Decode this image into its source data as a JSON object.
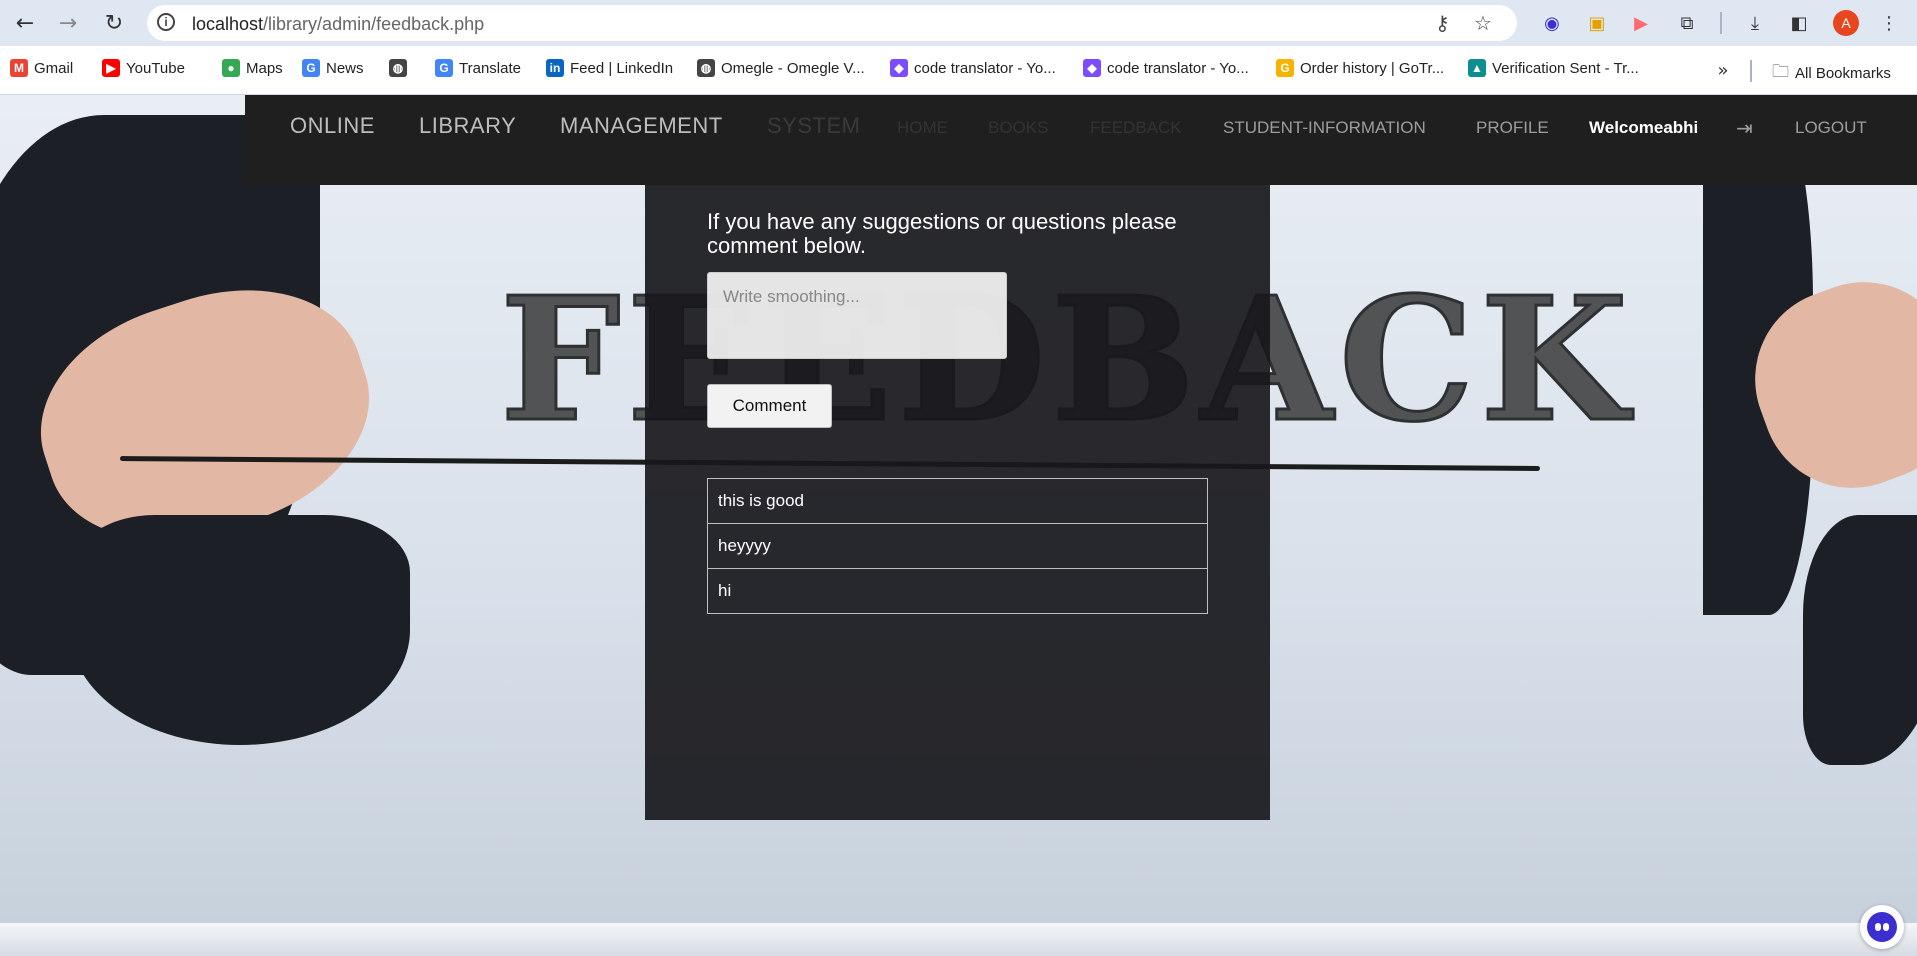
{
  "browser": {
    "url_host": "localhost",
    "url_path": "/library/admin/feedback.php",
    "avatar_letter": "A",
    "bookmarks": [
      {
        "label": "Gmail",
        "color": "#ea4335",
        "glyph": "M"
      },
      {
        "label": "YouTube",
        "color": "#ff0000",
        "glyph": "▶"
      },
      {
        "label": "Maps",
        "color": "#34a853",
        "glyph": "●"
      },
      {
        "label": "News",
        "color": "#4285f4",
        "glyph": "G"
      },
      {
        "label": "",
        "color": "#444444",
        "glyph": "◍"
      },
      {
        "label": "Translate",
        "color": "#4285f4",
        "glyph": "G"
      },
      {
        "label": "Feed | LinkedIn",
        "color": "#0a66c2",
        "glyph": "in"
      },
      {
        "label": "Omegle - Omegle V...",
        "color": "#444444",
        "glyph": "◍"
      },
      {
        "label": "code translator - Yo...",
        "color": "#7b4dff",
        "glyph": "◆"
      },
      {
        "label": "code translator - Yo...",
        "color": "#7b4dff",
        "glyph": "◆"
      },
      {
        "label": "Order history | GoTr...",
        "color": "#f4b400",
        "glyph": "G"
      },
      {
        "label": "Verification Sent - Tr...",
        "color": "#0b8f8f",
        "glyph": "▲"
      }
    ],
    "all_bookmarks_label": "All Bookmarks"
  },
  "nav": {
    "brand": [
      "ONLINE",
      "LIBRARY",
      "MANAGEMENT",
      "SYSTEM"
    ],
    "links": [
      "HOME",
      "BOOKS",
      "FEEDBACK",
      "STUDENT-INFORMATION",
      "PROFILE"
    ],
    "welcome": "Welcomeabhi",
    "logout": "LOGOUT"
  },
  "background_title": "FEEDBACK",
  "feedback": {
    "heading": "If you have any suggestions or questions please comment below.",
    "placeholder": "Write smoothing...",
    "button_label": "Comment",
    "comments": [
      "this is good",
      "heyyyy",
      "hi"
    ]
  }
}
